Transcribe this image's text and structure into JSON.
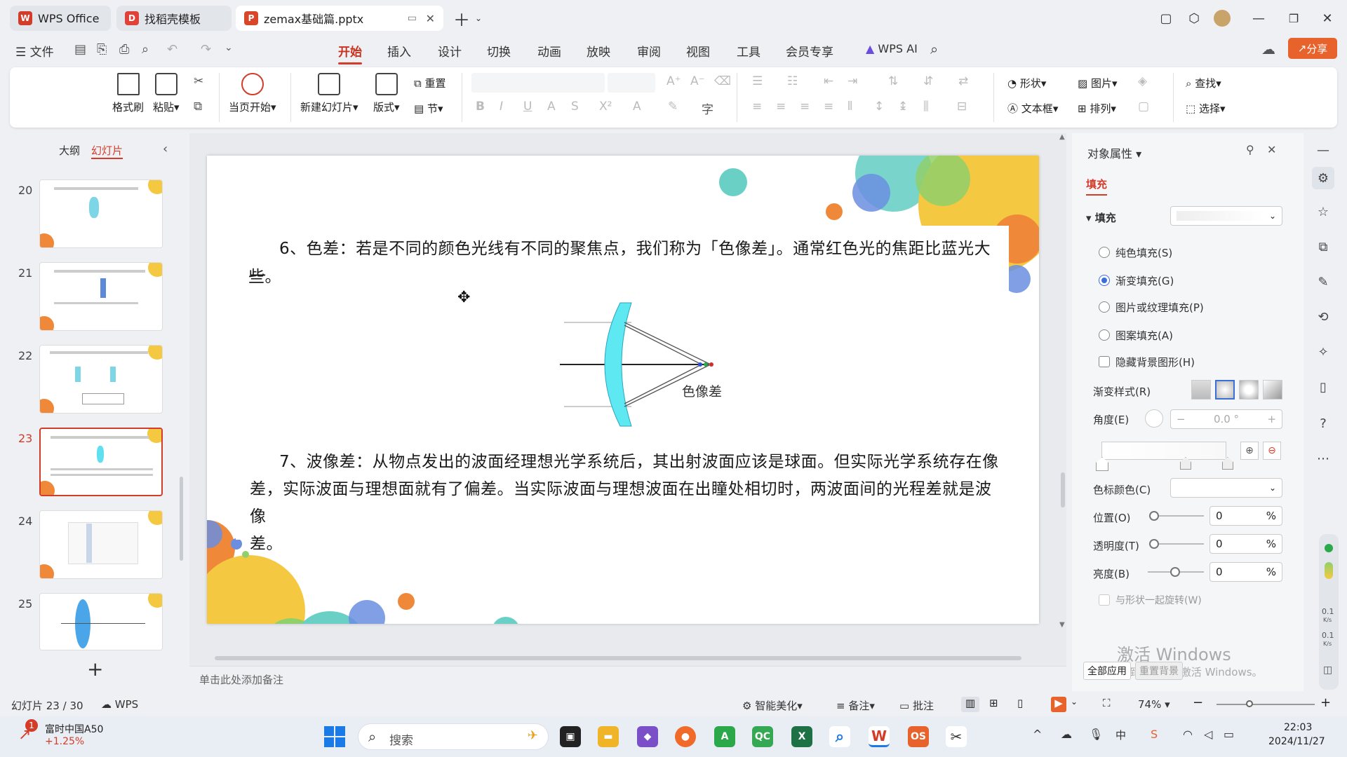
{
  "tabs": [
    {
      "label": "WPS Office",
      "icon": "wps-logo-icon"
    },
    {
      "label": "找稻壳模板",
      "icon": "docer-icon"
    },
    {
      "label": "zemax基础篇.pptx",
      "icon": "pptx-icon"
    }
  ],
  "menubar": {
    "file_label": "文件",
    "tabs": [
      "开始",
      "插入",
      "设计",
      "切换",
      "动画",
      "放映",
      "审阅",
      "视图",
      "工具",
      "会员专享"
    ],
    "active_tab": "开始",
    "wps_ai": "WPS AI",
    "share": "分享"
  },
  "ribbon": {
    "format_painter": "格式刷",
    "paste": "粘贴",
    "play_from_current": "当页开始",
    "new_slide": "新建幻灯片",
    "layout": "版式",
    "reset": "重置",
    "section": "节",
    "shape": "形状",
    "picture": "图片",
    "textbox": "文本框",
    "arrange": "排列",
    "find": "查找",
    "select": "选择"
  },
  "leftpanel": {
    "tab_outline": "大纲",
    "tab_slides": "幻灯片",
    "active_tab": "幻灯片",
    "thumbnails": [
      {
        "num": "20"
      },
      {
        "num": "21"
      },
      {
        "num": "22"
      },
      {
        "num": "23"
      },
      {
        "num": "24"
      },
      {
        "num": "25"
      }
    ],
    "selected": "23",
    "add_label": "+"
  },
  "slide": {
    "para1": "6、色差：若是不同的颜色光线有不同的聚焦点，我们称为「色像差」。通常红色光的焦距比蓝光大一",
    "para1_cont": "些。",
    "diagram_label": "色像差",
    "para2_line1": "7、波像差：从物点发出的波面经理想光学系统后，其出射波面应该是球面。但实际光学系统存在像",
    "para2_line2": "差，实际波面与理想面就有了偏差。当实际波面与理想波面在出瞳处相切时，两波面间的光程差就是波像",
    "para2_line3": "差。"
  },
  "notes_placeholder": "单击此处添加备注",
  "rightpanel": {
    "title": "对象属性",
    "section_tab": "填充",
    "fill_header": "填充",
    "options": [
      {
        "label": "纯色填充(S)",
        "checked": false
      },
      {
        "label": "渐变填充(G)",
        "checked": true
      },
      {
        "label": "图片或纹理填充(P)",
        "checked": false
      },
      {
        "label": "图案填充(A)",
        "checked": false
      }
    ],
    "hide_bg": "隐藏背景图形(H)",
    "gradient_style": "渐变样式(R)",
    "angle_label": "角度(E)",
    "angle_value": "0.0 °",
    "stop_color": "色标颜色(C)",
    "position_label": "位置(O)",
    "position_value": "0",
    "transparency_label": "透明度(T)",
    "transparency_value": "0",
    "brightness_label": "亮度(B)",
    "brightness_value": "0",
    "percent": "%",
    "rotate_with_shape": "与形状一起旋转(W)",
    "apply_all": "全部应用",
    "reset_bg": "重置背景",
    "watermark1": "激活 Windows",
    "watermark2": "转到\"设置\"以激活 Windows。"
  },
  "statusbar": {
    "slide_info": "幻灯片 23 / 30",
    "wps": "WPS",
    "smart_beautify": "智能美化",
    "notes": "备注",
    "comments": "批注",
    "zoom": "74%",
    "speed1": "0.1",
    "speed1_unit": "K/s",
    "speed2": "0.1",
    "speed2_unit": "K/s"
  },
  "taskbar": {
    "stock_name": "富时中国A50",
    "stock_change": "+1.25%",
    "stock_badge": "1",
    "search": "搜索",
    "time": "22:03",
    "date": "2024/11/27",
    "ime": "中"
  },
  "colors": {
    "accent": "#d43c2a",
    "teal": "#4cc9c0",
    "yellow": "#f5c842",
    "orange": "#f0883a",
    "blue": "#5b7fd6",
    "green": "#7cc84a"
  }
}
